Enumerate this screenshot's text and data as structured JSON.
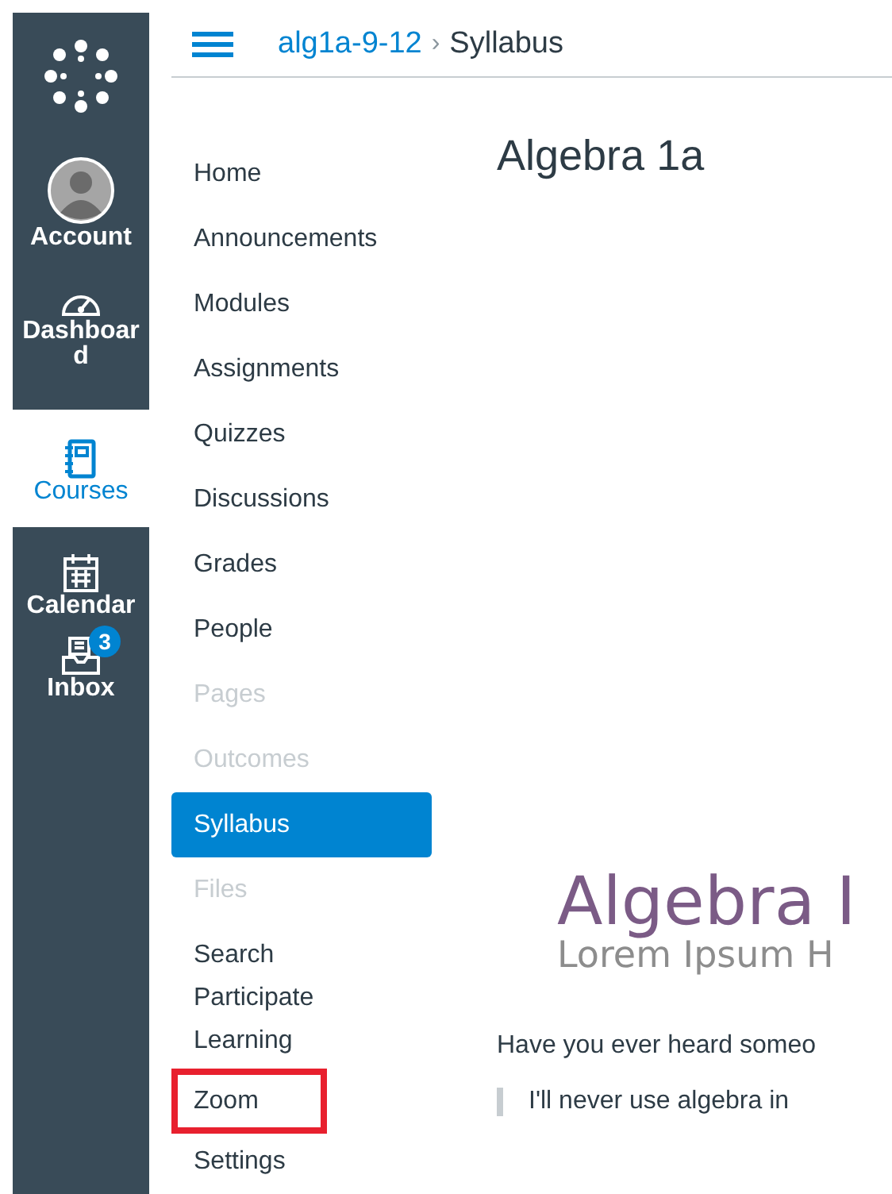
{
  "global_nav": [
    {
      "kind": "logo"
    },
    {
      "kind": "account",
      "label": "Account",
      "selected": false
    },
    {
      "kind": "dashboard",
      "label": "Dashboard",
      "selected": false
    },
    {
      "kind": "courses",
      "label": "Courses",
      "selected": true
    },
    {
      "kind": "calendar",
      "label": "Calendar",
      "selected": false
    },
    {
      "kind": "inbox",
      "label": "Inbox",
      "selected": false,
      "badge": "3"
    }
  ],
  "breadcrumb": [
    {
      "label": "alg1a-9-12",
      "kind": "link"
    },
    {
      "label": "›",
      "kind": "separator"
    },
    {
      "label": "Syllabus",
      "kind": "current"
    }
  ],
  "course_nav": [
    {
      "label": "Home",
      "selected": false,
      "disabled": false,
      "outlined": false
    },
    {
      "label": "Announcements",
      "selected": false,
      "disabled": false,
      "outlined": false
    },
    {
      "label": "Modules",
      "selected": false,
      "disabled": false,
      "outlined": false
    },
    {
      "label": "Assignments",
      "selected": false,
      "disabled": false,
      "outlined": false
    },
    {
      "label": "Quizzes",
      "selected": false,
      "disabled": false,
      "outlined": false
    },
    {
      "label": "Discussions",
      "selected": false,
      "disabled": false,
      "outlined": false
    },
    {
      "label": "Grades",
      "selected": false,
      "disabled": false,
      "outlined": false
    },
    {
      "label": "People",
      "selected": false,
      "disabled": false,
      "outlined": false
    },
    {
      "label": "Pages",
      "selected": false,
      "disabled": true,
      "outlined": false
    },
    {
      "label": "Outcomes",
      "selected": false,
      "disabled": true,
      "outlined": false
    },
    {
      "label": "Syllabus",
      "selected": true,
      "disabled": false,
      "outlined": false
    },
    {
      "label": "Files",
      "selected": false,
      "disabled": true,
      "outlined": false
    },
    {
      "label": "Search Participate Learning",
      "selected": false,
      "disabled": false,
      "outlined": false
    },
    {
      "label": "Zoom",
      "selected": false,
      "disabled": false,
      "outlined": true
    },
    {
      "label": "Settings",
      "selected": false,
      "disabled": false,
      "outlined": false
    }
  ],
  "content": {
    "title": "Algebra 1a",
    "banner_title": "Algebra I",
    "banner_subtitle": "Lorem Ipsum H",
    "paragraph": "Have you ever heard someo",
    "quote": "I'll never use algebra in"
  }
}
